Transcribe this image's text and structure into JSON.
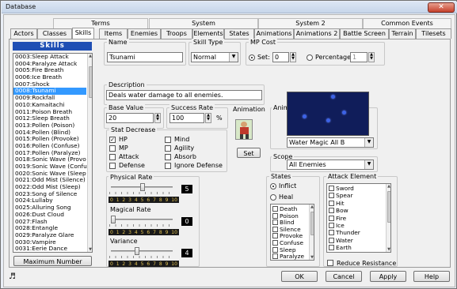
{
  "window": {
    "title": "Database",
    "close_glyph": "✕"
  },
  "tabs_top": [
    "Terms",
    "System",
    "System 2",
    "Common Events"
  ],
  "tabs_bottom": [
    "Actors",
    "Classes",
    "Skills",
    "Items",
    "Enemies",
    "Troops",
    "Elements",
    "States",
    "Animations",
    "Animations 2",
    "Battle Screen",
    "Terrain",
    "Tilesets"
  ],
  "selected_tab": "Skills",
  "skills_panel": {
    "header": "Skills",
    "items": [
      "0003:Sleep Attack",
      "0004:Paralyze Attack",
      "0005:Fire Breath",
      "0006:Ice Breath",
      "0007:Shock",
      "0008:Tsunami",
      "0009:Rockfall",
      "0010:Kamaitachi",
      "0011:Poison Breath",
      "0012:Sleep Breath",
      "0013:Pollen (Poison)",
      "0014:Pollen (Blind)",
      "0015:Pollen (Provoke)",
      "0016:Pollen (Confuse)",
      "0017:Pollen (Paralyze)",
      "0018:Sonic Wave (Provo",
      "0019:Sonic Wave (Confu",
      "0020:Sonic Wave (Sleep",
      "0021:Odd Mist (Silence)",
      "0022:Odd Mist (Sleep)",
      "0023:Song of Silence",
      "0024:Lullaby",
      "0025:Alluring Song",
      "0026:Dust Cloud",
      "0027:Flash",
      "0028:Entangle",
      "0029:Paralyze Glare",
      "0030:Vampire",
      "0031:Eerie Dance"
    ],
    "selected_index": 5,
    "max_button": "Maximum Number"
  },
  "name": {
    "label": "Name",
    "value": "Tsunami"
  },
  "skill_type": {
    "label": "Skill Type",
    "value": "Normal"
  },
  "mp_cost": {
    "label": "MP Cost",
    "set_label": "Set:",
    "set_value": "0",
    "percent_label": "Percentage:",
    "percent_value": "1"
  },
  "description": {
    "label": "Description",
    "value": "Deals water damage to all enemies."
  },
  "base_value": {
    "label": "Base Value",
    "value": "20"
  },
  "success_rate": {
    "label": "Success Rate",
    "value": "100",
    "unit": "%"
  },
  "animation_small": {
    "label": "Animation",
    "set_button": "Set"
  },
  "animations": {
    "label": "Animations",
    "selected": "Water Magic All B"
  },
  "stat_decrease": {
    "label": "Stat Decrease",
    "options": [
      {
        "label": "HP",
        "checked": true
      },
      {
        "label": "Mind",
        "checked": false
      },
      {
        "label": "MP",
        "checked": false
      },
      {
        "label": "Agility",
        "checked": false
      },
      {
        "label": "Attack",
        "checked": false
      },
      {
        "label": "Absorb",
        "checked": false
      },
      {
        "label": "Defense",
        "checked": false
      },
      {
        "label": "Ignore Defense",
        "checked": false
      }
    ]
  },
  "scope": {
    "label": "Scope",
    "value": "All Enemies"
  },
  "physical_rate": {
    "label": "Physical Rate",
    "value": "5",
    "fraction": 0.5
  },
  "magical_rate": {
    "label": "Magical Rate",
    "value": "0",
    "fraction": 0.0
  },
  "variance": {
    "label": "Variance",
    "value": "4",
    "fraction": 0.4
  },
  "scale_ticks": [
    "0",
    "1",
    "2",
    "3",
    "4",
    "5",
    "6",
    "7",
    "8",
    "9",
    "10"
  ],
  "states": {
    "label": "States",
    "inflict_label": "Inflict",
    "heal_label": "Heal",
    "items": [
      "Death",
      "Poison",
      "Blind",
      "Silence",
      "Provoke",
      "Confuse",
      "Sleep",
      "Paralyze"
    ]
  },
  "attack_element": {
    "label": "Attack Element",
    "items": [
      "Sword",
      "Spear",
      "Hit",
      "Bow",
      "Fire",
      "Ice",
      "Thunder",
      "Water",
      "Earth"
    ],
    "reduce_label": "Reduce Resistance"
  },
  "footer": {
    "ok": "OK",
    "cancel": "Cancel",
    "apply": "Apply",
    "help": "Help",
    "music_icon": "♬"
  }
}
